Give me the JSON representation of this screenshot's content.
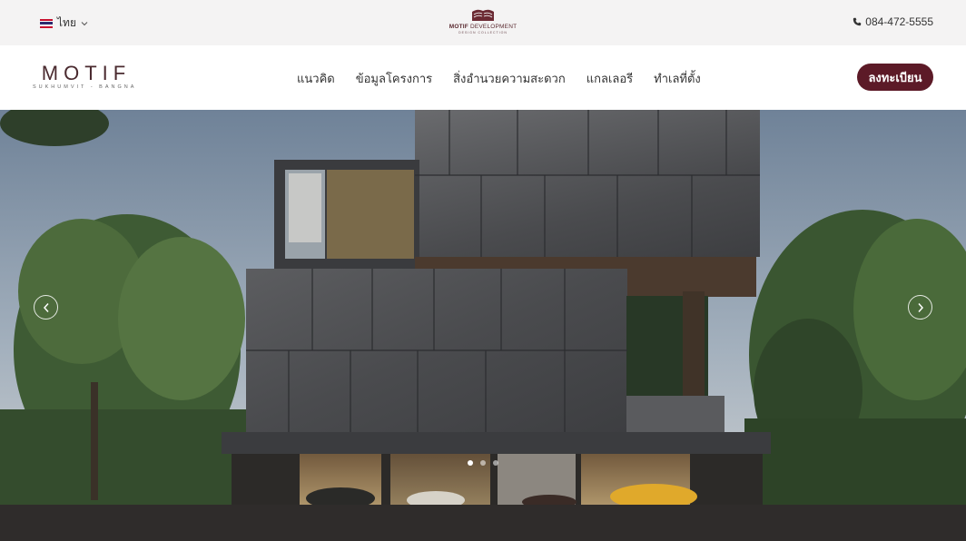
{
  "topbar": {
    "language": "ไทย",
    "developer_logo": {
      "name_bold": "MOTIF",
      "name_rest": " DEVELOPMENT",
      "tagline": "DESIGN COLLECTION"
    },
    "phone": "084-472-5555"
  },
  "navbar": {
    "brand": {
      "name": "MOTIF",
      "tagline": "SUKHUMVIT - BANGNA"
    },
    "menu": [
      {
        "label": "แนวคิด"
      },
      {
        "label": "ข้อมูลโครงการ"
      },
      {
        "label": "สิ่งอำนวยความสะดวก"
      },
      {
        "label": "แกลเลอรี"
      },
      {
        "label": "ทำเลที่ตั้ง"
      }
    ],
    "cta_label": "ลงทะเบียน"
  },
  "hero": {
    "slides_total": 3,
    "active_slide": 1
  },
  "colors": {
    "brand_maroon": "#5c1a27",
    "topbar_bg": "#f4f3f3",
    "footer_bg": "#2f2c2b"
  },
  "icons": {
    "flag": "thai-flag-icon",
    "chevron": "chevron-down-icon",
    "phone": "phone-icon",
    "prev": "chevron-left-icon",
    "next": "chevron-right-icon"
  }
}
